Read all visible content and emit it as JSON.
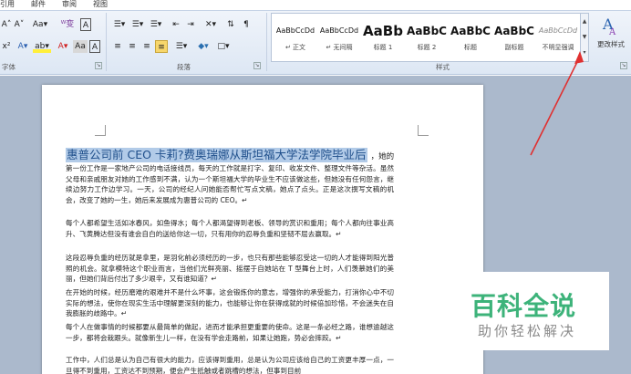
{
  "ribbon": {
    "tabs": [
      "引用",
      "邮件",
      "审阅",
      "视图"
    ],
    "row1_left": [
      "A˄",
      "A˅",
      "Aa▾",
      "ᵂ变",
      "A"
    ],
    "row2_left": [
      "x²",
      "A▾",
      "ab▾",
      "A▾",
      "Aa",
      "A"
    ],
    "paragraph_row1": [
      "☰▾",
      "☰▾",
      "☰▾",
      "⇤",
      "⇥",
      "✕▾",
      "⇅",
      "¶"
    ],
    "paragraph_row2": [
      "≡",
      "≡",
      "≡",
      "≡",
      "☰▾",
      "◆▾",
      "□▾"
    ],
    "font_group_label": "字体",
    "paragraph_group_label": "段落",
    "styles_group_label": "样式",
    "change_styles_label": "更改样式",
    "styles": [
      {
        "sample": "AaBbCcDd",
        "name": "↵ 正文"
      },
      {
        "sample": "AaBbCcDd",
        "name": "↵ 无间隔"
      },
      {
        "sample": "AaBb",
        "name": "标题 1"
      },
      {
        "sample": "AaBbC",
        "name": "标题 2"
      },
      {
        "sample": "AaBbC",
        "name": "标题"
      },
      {
        "sample": "AaBbC",
        "name": "副标题"
      },
      {
        "sample": "AaBbCcDd",
        "name": "不明显强调"
      }
    ]
  },
  "document": {
    "title": "惠普公司前 CEO 卡莉?费奥瑞娜从斯坦福大学法学院毕业后",
    "title_tail": "，她的",
    "paragraphs": [
      "第一份工作是一家地产公司的电话接线员，每天的工作就是打字、复印、收发文件、整理文件等杂活。虽然父母和亲戚朋友对她的工作感到不满，认为一个斯坦福大学的毕业生不应该做这些，但她没有任何怨言，继续边努力工作边学习。一天，公司的经纪人问她能否帮忙写点文稿，她点了点头。正是这次撰写文稿的机会，改变了她的一生，她后来发展成为惠普公司的 CEO。↵",
      "每个人都希望生活如冰春风，如鱼得水；每个人都渴望得到老板、领导的赏识和重用；每个人都向往事业高升、飞黄腾达但没有谁会自白的送给你这一切，只有用你的忍辱负重和坚韧不屈去赢取。↵",
      "这段忍辱负重的经历就是拿里，是羽化前必须经历的一步，也只有那些能够忍受这一切的人才能得到阳光普照的机会。就拿模特这个职业而言，当他们光鲜亮丽、摇摆于自她站在 T 型舞台上时，人们羡慕她们的美丽，但她们背后付出了多少艰辛，又有谁知道？↵",
      "在开始的时候，经历磨难的艰难并不是什么坏事，这会锻炼你的意志，增强你的承受能力，打消你心中不切实际的想法，使你在现实生活中理解更深刻的能力，也能够让你在获得成就的时候倍加珍惜，不会迷失在自我膨胀的歧路中。↵",
      "每个人在做事情的时候都要从最简单的做起，进而才能承担更重要的使命。这是一条必经之路，谁想逾越这一步，都将会栽跟头。就像新生儿一样，在没有学会走路前，如果让她跑，势必会摔跤。↵",
      "工作中，人们总是认为自己有很大的能力，应该得到重用，总是认为公司应该给自己的工资更丰厚一点，一旦得不到重用，工资达不到预期，便会产生抵触或者跳槽的想法，但事到目前"
    ]
  },
  "watermark": {
    "title": "百科全说",
    "subtitle": "助你轻松解决"
  },
  "colors": {
    "title_highlight": "#b2cbe8",
    "title_text": "#1f4f8b",
    "watermark_green": "#3db37a",
    "arrow": "#e03030"
  }
}
